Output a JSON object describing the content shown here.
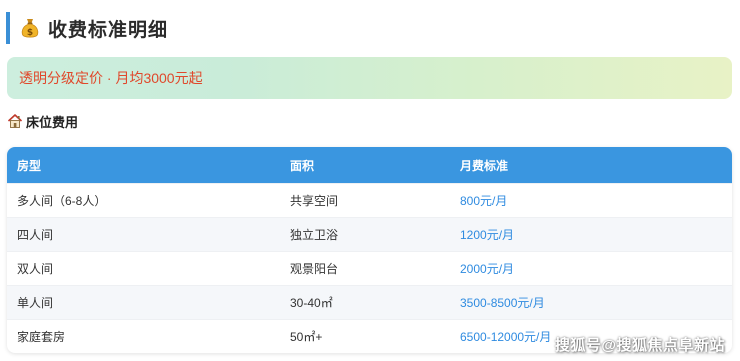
{
  "header": {
    "title": "收费标准明细",
    "icon": "money-bag-icon"
  },
  "banner": {
    "text": "透明分级定价 · 月均3000元起"
  },
  "section": {
    "title": "床位费用",
    "icon": "house-icon"
  },
  "table": {
    "columns": [
      "房型",
      "面积",
      "月费标准"
    ],
    "rows": [
      {
        "type": "多人间（6-8人）",
        "area": "共享空间",
        "fee": "800元/月"
      },
      {
        "type": "四人间",
        "area": "独立卫浴",
        "fee": "1200元/月"
      },
      {
        "type": "双人间",
        "area": "观景阳台",
        "fee": "2000元/月"
      },
      {
        "type": "单人间",
        "area": "30-40㎡",
        "fee": "3500-8500元/月"
      },
      {
        "type": "家庭套房",
        "area": "50㎡+",
        "fee": "6500-12000元/月"
      }
    ]
  },
  "watermark": {
    "text": "搜狐号@搜狐焦点阜新站"
  },
  "colors": {
    "accent": "#3a8fd6",
    "table_header": "#3a96e0",
    "price": "#2f8be0",
    "banner_text": "#e0482b"
  }
}
